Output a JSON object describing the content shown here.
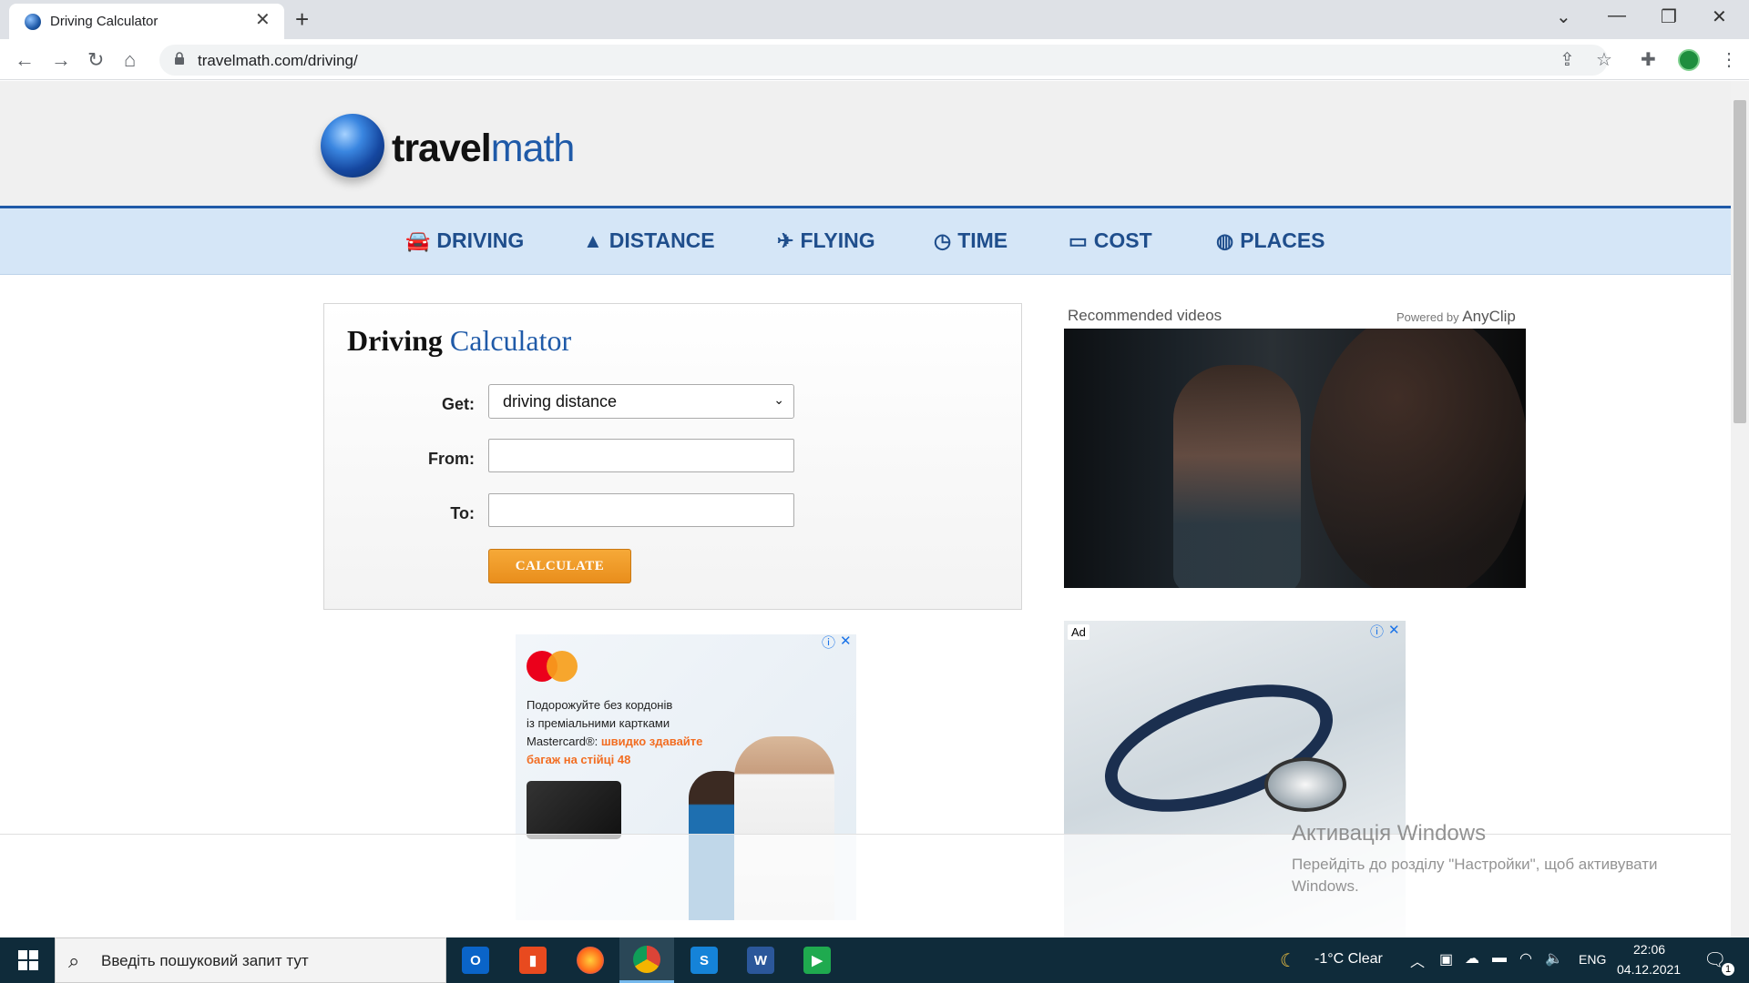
{
  "browser": {
    "tab_title": "Driving Calculator",
    "url": "travelmath.com/driving/"
  },
  "logo": {
    "part1": "travel",
    "part2": "math"
  },
  "nav": [
    {
      "icon": "🚘",
      "label": "DRIVING"
    },
    {
      "icon": "▲",
      "label": "DISTANCE"
    },
    {
      "icon": "✈",
      "label": "FLYING"
    },
    {
      "icon": "◷",
      "label": "TIME"
    },
    {
      "icon": "▭",
      "label": "COST"
    },
    {
      "icon": "◍",
      "label": "PLACES"
    }
  ],
  "calculator": {
    "title_part1": "Driving",
    "title_part2": "Calculator",
    "get_label": "Get:",
    "get_value": "driving distance",
    "from_label": "From:",
    "from_value": "",
    "to_label": "To:",
    "to_value": "",
    "button": "CALCULATE"
  },
  "video": {
    "label": "Recommended videos",
    "powered_by": "Powered by",
    "brand": "AnyClip"
  },
  "ad1": {
    "line1": "Подорожуйте без кордонів",
    "line2": "із преміальними картками",
    "line3": "Mastercard®:",
    "highlight1": "швидко здавайте",
    "highlight2": "багаж на стійці 48"
  },
  "ad2": {
    "label": "Ad"
  },
  "activation": {
    "title": "Активація Windows",
    "text1": "Перейдіть до розділу \"Настройки\", щоб активувати",
    "text2": "Windows."
  },
  "taskbar": {
    "search_placeholder": "Введіть пошуковий запит тут",
    "weather": "-1°C  Clear",
    "lang": "ENG",
    "time": "22:06",
    "date": "04.12.2021",
    "notif_count": "1"
  }
}
